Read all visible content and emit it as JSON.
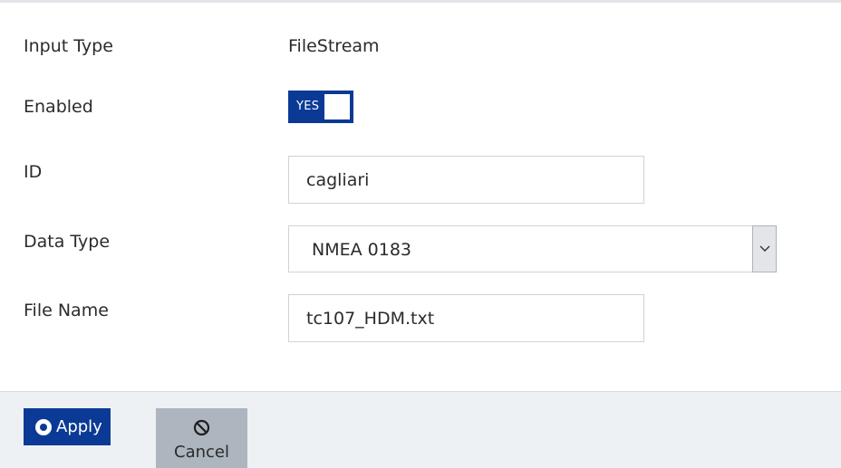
{
  "form": {
    "input_type": {
      "label": "Input Type",
      "value": "FileStream"
    },
    "enabled": {
      "label": "Enabled",
      "toggle_text": "YES",
      "on": true
    },
    "id": {
      "label": "ID",
      "value": "cagliari"
    },
    "data_type": {
      "label": "Data Type",
      "selected": "NMEA 0183"
    },
    "file_name": {
      "label": "File Name",
      "value": "tc107_HDM.txt"
    }
  },
  "footer": {
    "apply_label": "Apply",
    "cancel_label": "Cancel"
  },
  "colors": {
    "primary": "#0b3a96",
    "footer_bg": "#eef1f4",
    "cancel_bg": "#adb6be"
  },
  "icons": {
    "apply": "radio-dot-icon",
    "cancel": "ban-icon",
    "select": "chevron-down-icon"
  }
}
